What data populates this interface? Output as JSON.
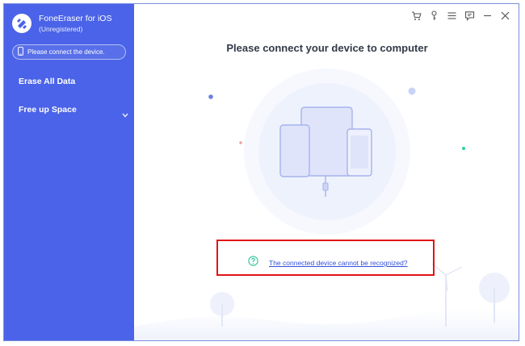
{
  "app": {
    "title": "FoneEraser for iOS",
    "subtitle": "(Unregistered)"
  },
  "sidebar": {
    "device_status": "Please connect the device.",
    "items": [
      {
        "label": "Erase All Data"
      },
      {
        "label": "Free up Space"
      }
    ]
  },
  "main": {
    "title": "Please connect your device to computer",
    "help_link": "The connected device cannot be recognized?"
  },
  "colors": {
    "sidebar": "#4a63e8",
    "accent": "#3350d8",
    "highlight_box": "#e01515",
    "help_icon": "#2ec49a"
  },
  "icons": [
    "logo-icon",
    "phone-icon",
    "chevron-down-icon",
    "cart-icon",
    "key-icon",
    "menu-icon",
    "feedback-icon",
    "minimize-icon",
    "close-icon",
    "question-icon"
  ]
}
